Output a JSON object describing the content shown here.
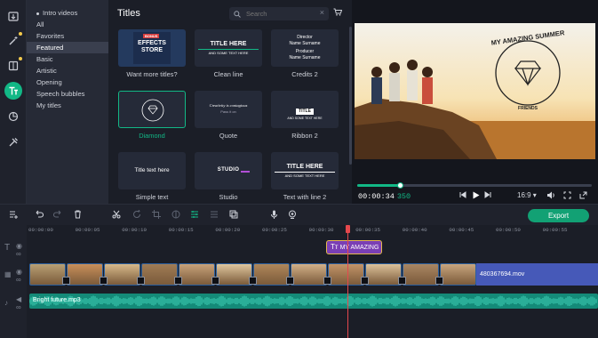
{
  "categories": {
    "items": [
      "Intro videos",
      "All",
      "Favorites",
      "Featured",
      "Basic",
      "Artistic",
      "Opening",
      "Speech bubbles",
      "My titles"
    ],
    "selected": "Featured"
  },
  "titles_panel": {
    "heading": "Titles",
    "search_placeholder": "Search",
    "tiles": [
      {
        "label": "Want more titles?",
        "preview": "EFFECTS STORE",
        "badge": "BONUS"
      },
      {
        "label": "Clean line",
        "preview": "TITLE HERE",
        "sub": "AND SOME TEXT HERE"
      },
      {
        "label": "Credits 2",
        "preview": "Director",
        "sub": "Name Surname",
        "preview2": "Producer",
        "sub2": "Name Surname"
      },
      {
        "label": "Diamond",
        "selected": true
      },
      {
        "label": "Quote",
        "preview": "Creativity is contagious",
        "sub": "Pass it on"
      },
      {
        "label": "Ribbon 2",
        "preview": "TITLE",
        "sub": "AND SOME TEXT HERE"
      },
      {
        "label": "Simple text",
        "preview": "Title text here"
      },
      {
        "label": "Studio",
        "preview": "STUDIO"
      },
      {
        "label": "Text with line 2",
        "preview": "TITLE HERE",
        "sub": "AND SOME TEXT HERE"
      }
    ]
  },
  "player": {
    "overlay_title": "MY AMAZING SUMMER",
    "overlay_sub": "FRIENDS",
    "timecode": "00:00:34",
    "timecode_frames": "350",
    "aspect": "16:9",
    "progress_fraction": 0.18
  },
  "toolbar": {
    "export_label": "Export"
  },
  "timeline": {
    "ticks": [
      "00:00:00",
      "00:00:05",
      "00:00:10",
      "00:00:15",
      "00:00:20",
      "00:00:25",
      "00:00:30",
      "00:00:35",
      "00:00:40",
      "00:00:45",
      "00:00:50",
      "00:00:55"
    ],
    "title_clip": "MY AMAZING",
    "video_clip_name": "480367694.mov",
    "audio_clip_name": "Bright future.mp3"
  },
  "colors": {
    "accent": "#12b886",
    "playhead": "#e5484d",
    "title_clip": "#7a3fb5",
    "audio": "#148a78",
    "video_clip": "#4659b8"
  }
}
